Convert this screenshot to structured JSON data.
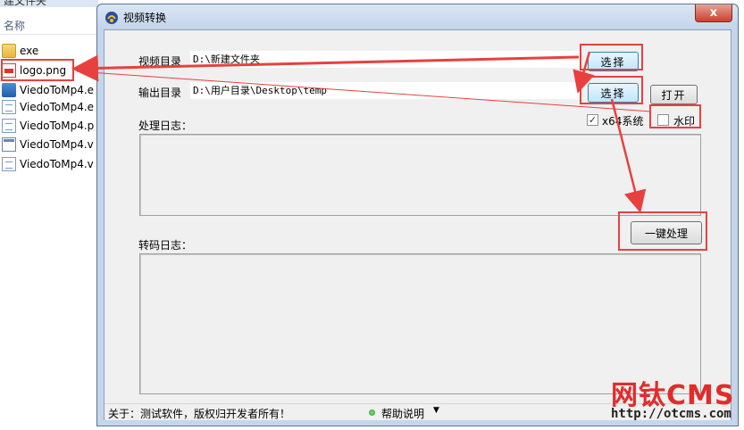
{
  "explorer": {
    "top_partial": "建文件夹",
    "header_name": "名称",
    "files": [
      {
        "name": "exe",
        "icon": "folder-icon"
      },
      {
        "name": "logo.png",
        "icon": "png-file-icon"
      },
      {
        "name": "ViedoToMp4.e",
        "icon": "exe-file-icon"
      },
      {
        "name": "ViedoToMp4.e",
        "icon": "config-file-icon"
      },
      {
        "name": "ViedoToMp4.p",
        "icon": "document-file-icon"
      },
      {
        "name": "ViedoToMp4.v",
        "icon": "window-file-icon"
      },
      {
        "name": "ViedoToMp4.v",
        "icon": "config-file-icon"
      }
    ]
  },
  "window": {
    "title": "视频转换",
    "close_label": "x"
  },
  "form": {
    "video_dir_label": "视频目录",
    "video_dir_value": "D:\\新建文件夹",
    "output_dir_label": "输出目录",
    "output_dir_value": "D:\\用户目录\\Desktop\\temp",
    "select_label": "选择",
    "select_label_2": "选择",
    "open_label": "打开",
    "x64_label": "x64系统",
    "x64_checked": true,
    "watermark_label": "水印",
    "watermark_checked": false,
    "process_log_label": "处理日志：",
    "transcode_log_label": "转码日志：",
    "one_click_label": "一键处理"
  },
  "statusbar": {
    "about": "关于：测试软件，版权归开发者所有！",
    "help": "帮助说明"
  },
  "branding": {
    "name": "网钛CMS",
    "url": "http://otcms.com"
  },
  "colors": {
    "annotation_red": "#e8403f",
    "brand_red": "#e32b2b"
  }
}
